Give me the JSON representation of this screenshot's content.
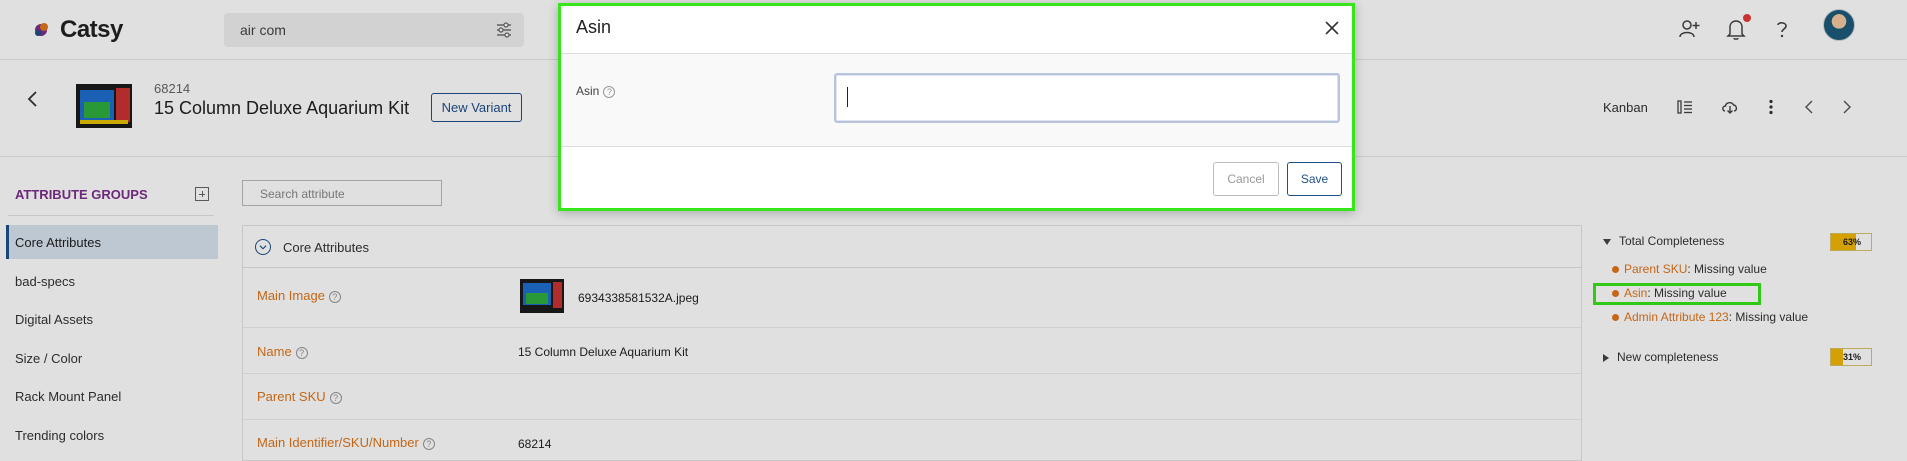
{
  "app": {
    "name": "Catsy"
  },
  "search": {
    "value": "air com"
  },
  "product": {
    "id": "68214",
    "title": "15 Column Deluxe Aquarium Kit",
    "new_variant_label": "New Variant"
  },
  "header_actions": {
    "kanban_label": "Kanban"
  },
  "sidebar": {
    "title": "ATTRIBUTE GROUPS",
    "items": [
      {
        "label": "Core Attributes",
        "active": true
      },
      {
        "label": "bad-specs"
      },
      {
        "label": "Digital Assets"
      },
      {
        "label": "Size / Color"
      },
      {
        "label": "Rack Mount Panel"
      },
      {
        "label": "Trending colors"
      }
    ]
  },
  "attribute_search": {
    "placeholder": "Search attribute"
  },
  "section": {
    "title": "Core Attributes"
  },
  "attributes": [
    {
      "label": "Main Image",
      "value": "6934338581532A.jpeg"
    },
    {
      "label": "Name",
      "value": "15 Column Deluxe Aquarium Kit"
    },
    {
      "label": "Parent SKU",
      "value": ""
    },
    {
      "label": "Main Identifier/SKU/Number",
      "value": "68214"
    }
  ],
  "completeness": {
    "total": {
      "label": "Total Completeness",
      "percent": 63,
      "percent_label": "63%"
    },
    "missing": [
      {
        "name": "Parent SKU",
        "text": ": Missing value"
      },
      {
        "name": "Asin",
        "text": ": Missing value"
      },
      {
        "name": "Admin Attribute 123",
        "text": ": Missing value"
      }
    ],
    "new": {
      "label": "New completeness",
      "percent": 31,
      "percent_label": "31%"
    }
  },
  "dialog": {
    "title": "Asin",
    "field_label": "Asin",
    "input_value": "",
    "cancel_label": "Cancel",
    "save_label": "Save"
  },
  "colors": {
    "accent": "#1f4e8a",
    "attribute_label": "#e0761b",
    "highlight": "#37e61a",
    "progress": "#f2b705"
  }
}
